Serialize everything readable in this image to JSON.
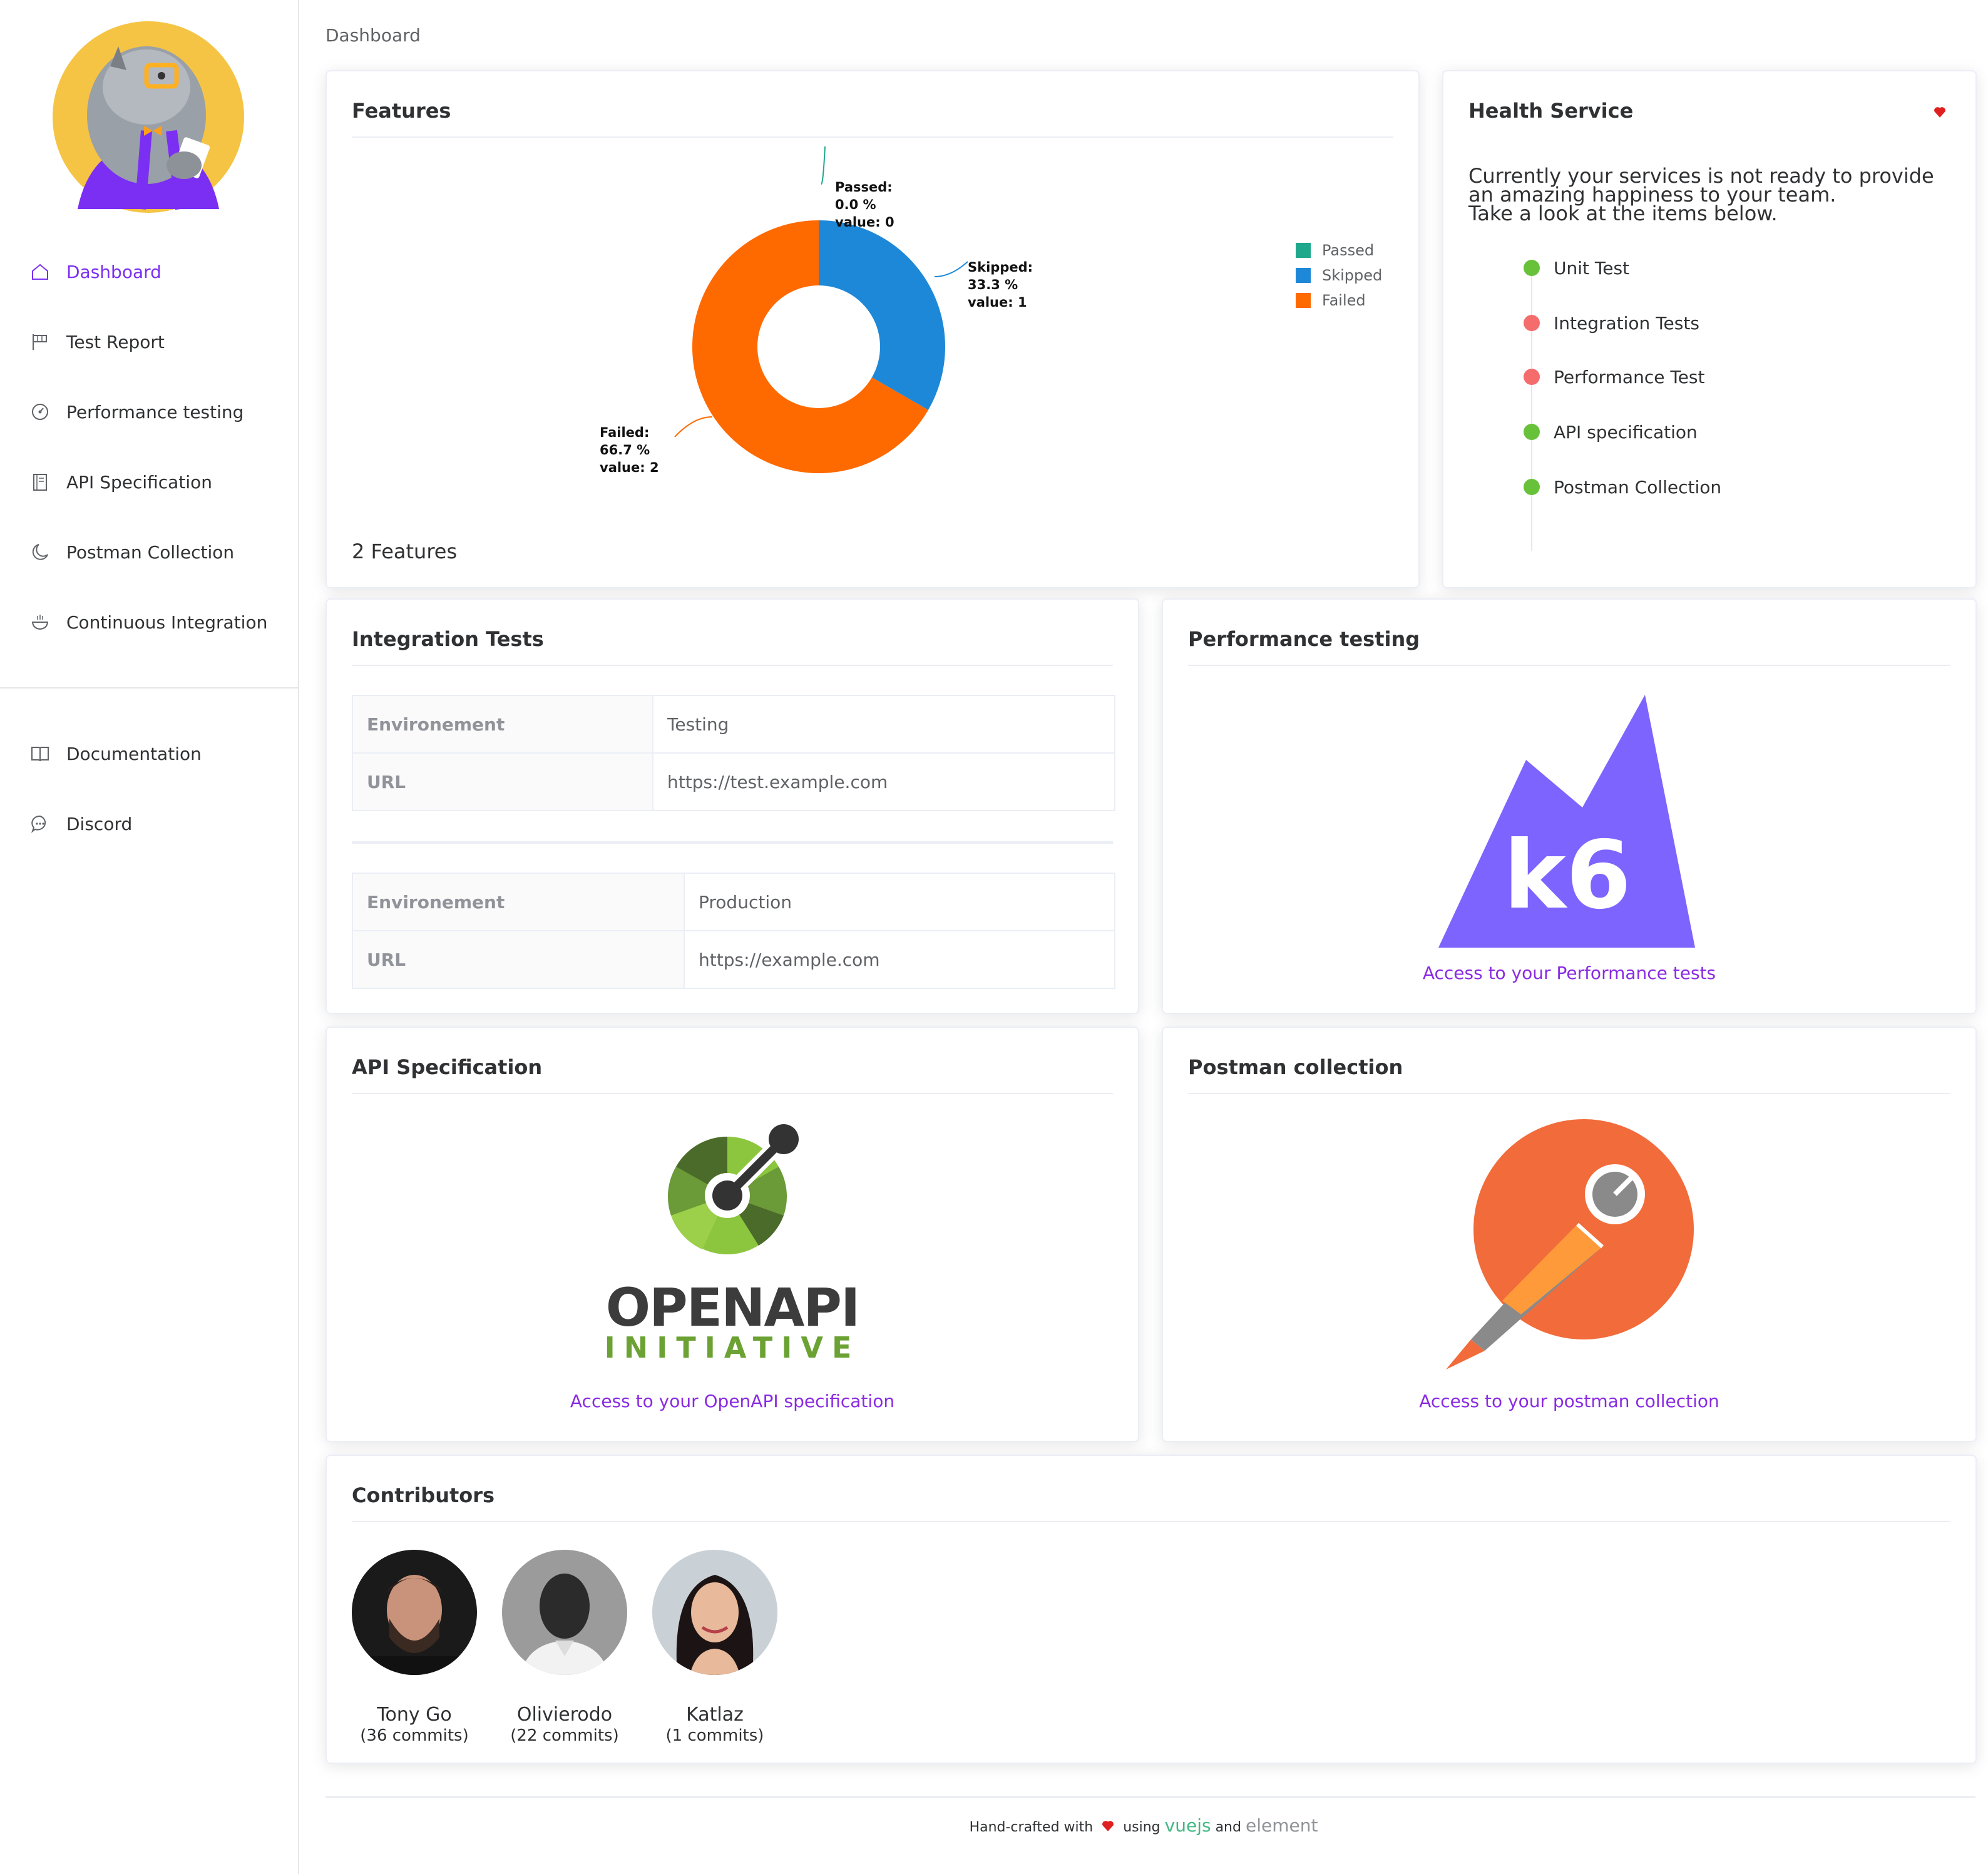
{
  "breadcrumb": "Dashboard",
  "sidebar": {
    "items": [
      {
        "label": "Dashboard",
        "icon": "home-icon",
        "active": true
      },
      {
        "label": "Test Report",
        "icon": "flag-icon"
      },
      {
        "label": "Performance testing",
        "icon": "odometer-icon"
      },
      {
        "label": "API Specification",
        "icon": "notebook-icon"
      },
      {
        "label": "Postman Collection",
        "icon": "moon-icon"
      },
      {
        "label": "Continuous Integration",
        "icon": "bowl-icon"
      }
    ],
    "links": [
      {
        "label": "Documentation",
        "icon": "book-icon"
      },
      {
        "label": "Discord",
        "icon": "chat-icon"
      }
    ]
  },
  "features": {
    "title": "Features",
    "summary": "2 Features",
    "chart_data": {
      "type": "pie",
      "categories": [
        "Passed",
        "Skipped",
        "Failed"
      ],
      "values": [
        0,
        1,
        2
      ],
      "percent": [
        "0.0",
        "33.3",
        "66.7"
      ],
      "colors": [
        "#1fa88c",
        "#1e88d8",
        "#ff6a00"
      ],
      "labels": [
        {
          "name": "Passed:",
          "pct": "0.0 %",
          "val": "value: 0"
        },
        {
          "name": "Skipped:",
          "pct": "33.3 %",
          "val": "value: 1"
        },
        {
          "name": "Failed:",
          "pct": "66.7 %",
          "val": "value: 2"
        }
      ],
      "legend": "right"
    }
  },
  "health": {
    "title": "Health Service",
    "text_lines": [
      "Currently your services is not ready to provide",
      "an amazing happiness to your team.",
      "Take a look at the items below."
    ],
    "items": [
      {
        "label": "Unit Test",
        "status": "ok"
      },
      {
        "label": "Integration Tests",
        "status": "error"
      },
      {
        "label": "Performance Test",
        "status": "error"
      },
      {
        "label": "API specification",
        "status": "ok"
      },
      {
        "label": "Postman Collection",
        "status": "ok"
      }
    ],
    "colors": {
      "ok": "#67c23a",
      "error": "#f56c6c"
    }
  },
  "integration": {
    "title": "Integration Tests",
    "envs": [
      {
        "env_label": "Environement",
        "env": "Testing",
        "url_label": "URL",
        "url": "https://test.example.com"
      },
      {
        "env_label": "Environement",
        "env": "Production",
        "url_label": "URL",
        "url": "https://example.com"
      }
    ]
  },
  "performance": {
    "title": "Performance testing",
    "logo_text": "k6",
    "link": "Access to your Performance tests"
  },
  "api": {
    "title": "API Specification",
    "logo_line1": "OPENAPI",
    "logo_line2": "INITIATIVE",
    "link": "Access to your OpenAPI specification"
  },
  "postman": {
    "title": "Postman collection",
    "link": "Access to your postman collection"
  },
  "contributors": {
    "title": "Contributors",
    "people": [
      {
        "name": "Tony Go",
        "commits": "(36 commits)"
      },
      {
        "name": "Olivierodo",
        "commits": "(22 commits)"
      },
      {
        "name": "Katlaz",
        "commits": "(1 commits)"
      }
    ]
  },
  "footer": {
    "prefix": "Hand-crafted with",
    "using": "using",
    "vue": "vuejs",
    "and": "and",
    "element": "element"
  }
}
